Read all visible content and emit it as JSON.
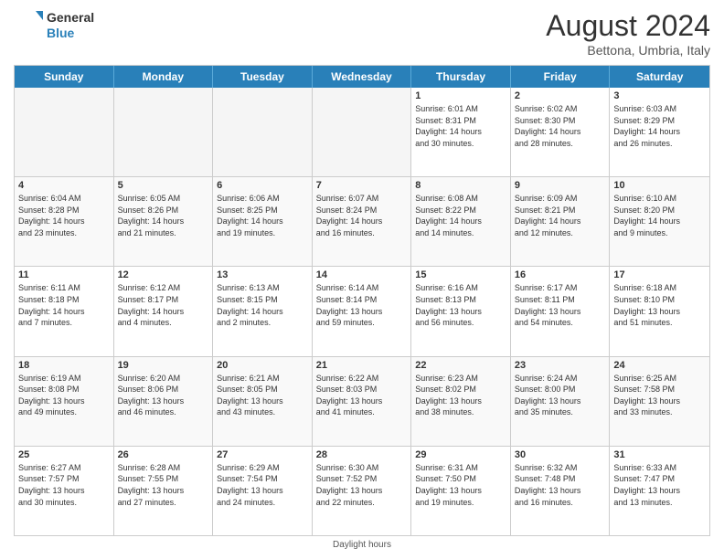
{
  "header": {
    "logo_general": "General",
    "logo_blue": "Blue",
    "month_title": "August 2024",
    "location": "Bettona, Umbria, Italy"
  },
  "days_of_week": [
    "Sunday",
    "Monday",
    "Tuesday",
    "Wednesday",
    "Thursday",
    "Friday",
    "Saturday"
  ],
  "weeks": [
    [
      {
        "day": "",
        "info": "",
        "empty": true
      },
      {
        "day": "",
        "info": "",
        "empty": true
      },
      {
        "day": "",
        "info": "",
        "empty": true
      },
      {
        "day": "",
        "info": "",
        "empty": true
      },
      {
        "day": "1",
        "info": "Sunrise: 6:01 AM\nSunset: 8:31 PM\nDaylight: 14 hours\nand 30 minutes.",
        "empty": false
      },
      {
        "day": "2",
        "info": "Sunrise: 6:02 AM\nSunset: 8:30 PM\nDaylight: 14 hours\nand 28 minutes.",
        "empty": false
      },
      {
        "day": "3",
        "info": "Sunrise: 6:03 AM\nSunset: 8:29 PM\nDaylight: 14 hours\nand 26 minutes.",
        "empty": false
      }
    ],
    [
      {
        "day": "4",
        "info": "Sunrise: 6:04 AM\nSunset: 8:28 PM\nDaylight: 14 hours\nand 23 minutes.",
        "empty": false
      },
      {
        "day": "5",
        "info": "Sunrise: 6:05 AM\nSunset: 8:26 PM\nDaylight: 14 hours\nand 21 minutes.",
        "empty": false
      },
      {
        "day": "6",
        "info": "Sunrise: 6:06 AM\nSunset: 8:25 PM\nDaylight: 14 hours\nand 19 minutes.",
        "empty": false
      },
      {
        "day": "7",
        "info": "Sunrise: 6:07 AM\nSunset: 8:24 PM\nDaylight: 14 hours\nand 16 minutes.",
        "empty": false
      },
      {
        "day": "8",
        "info": "Sunrise: 6:08 AM\nSunset: 8:22 PM\nDaylight: 14 hours\nand 14 minutes.",
        "empty": false
      },
      {
        "day": "9",
        "info": "Sunrise: 6:09 AM\nSunset: 8:21 PM\nDaylight: 14 hours\nand 12 minutes.",
        "empty": false
      },
      {
        "day": "10",
        "info": "Sunrise: 6:10 AM\nSunset: 8:20 PM\nDaylight: 14 hours\nand 9 minutes.",
        "empty": false
      }
    ],
    [
      {
        "day": "11",
        "info": "Sunrise: 6:11 AM\nSunset: 8:18 PM\nDaylight: 14 hours\nand 7 minutes.",
        "empty": false
      },
      {
        "day": "12",
        "info": "Sunrise: 6:12 AM\nSunset: 8:17 PM\nDaylight: 14 hours\nand 4 minutes.",
        "empty": false
      },
      {
        "day": "13",
        "info": "Sunrise: 6:13 AM\nSunset: 8:15 PM\nDaylight: 14 hours\nand 2 minutes.",
        "empty": false
      },
      {
        "day": "14",
        "info": "Sunrise: 6:14 AM\nSunset: 8:14 PM\nDaylight: 13 hours\nand 59 minutes.",
        "empty": false
      },
      {
        "day": "15",
        "info": "Sunrise: 6:16 AM\nSunset: 8:13 PM\nDaylight: 13 hours\nand 56 minutes.",
        "empty": false
      },
      {
        "day": "16",
        "info": "Sunrise: 6:17 AM\nSunset: 8:11 PM\nDaylight: 13 hours\nand 54 minutes.",
        "empty": false
      },
      {
        "day": "17",
        "info": "Sunrise: 6:18 AM\nSunset: 8:10 PM\nDaylight: 13 hours\nand 51 minutes.",
        "empty": false
      }
    ],
    [
      {
        "day": "18",
        "info": "Sunrise: 6:19 AM\nSunset: 8:08 PM\nDaylight: 13 hours\nand 49 minutes.",
        "empty": false
      },
      {
        "day": "19",
        "info": "Sunrise: 6:20 AM\nSunset: 8:06 PM\nDaylight: 13 hours\nand 46 minutes.",
        "empty": false
      },
      {
        "day": "20",
        "info": "Sunrise: 6:21 AM\nSunset: 8:05 PM\nDaylight: 13 hours\nand 43 minutes.",
        "empty": false
      },
      {
        "day": "21",
        "info": "Sunrise: 6:22 AM\nSunset: 8:03 PM\nDaylight: 13 hours\nand 41 minutes.",
        "empty": false
      },
      {
        "day": "22",
        "info": "Sunrise: 6:23 AM\nSunset: 8:02 PM\nDaylight: 13 hours\nand 38 minutes.",
        "empty": false
      },
      {
        "day": "23",
        "info": "Sunrise: 6:24 AM\nSunset: 8:00 PM\nDaylight: 13 hours\nand 35 minutes.",
        "empty": false
      },
      {
        "day": "24",
        "info": "Sunrise: 6:25 AM\nSunset: 7:58 PM\nDaylight: 13 hours\nand 33 minutes.",
        "empty": false
      }
    ],
    [
      {
        "day": "25",
        "info": "Sunrise: 6:27 AM\nSunset: 7:57 PM\nDaylight: 13 hours\nand 30 minutes.",
        "empty": false
      },
      {
        "day": "26",
        "info": "Sunrise: 6:28 AM\nSunset: 7:55 PM\nDaylight: 13 hours\nand 27 minutes.",
        "empty": false
      },
      {
        "day": "27",
        "info": "Sunrise: 6:29 AM\nSunset: 7:54 PM\nDaylight: 13 hours\nand 24 minutes.",
        "empty": false
      },
      {
        "day": "28",
        "info": "Sunrise: 6:30 AM\nSunset: 7:52 PM\nDaylight: 13 hours\nand 22 minutes.",
        "empty": false
      },
      {
        "day": "29",
        "info": "Sunrise: 6:31 AM\nSunset: 7:50 PM\nDaylight: 13 hours\nand 19 minutes.",
        "empty": false
      },
      {
        "day": "30",
        "info": "Sunrise: 6:32 AM\nSunset: 7:48 PM\nDaylight: 13 hours\nand 16 minutes.",
        "empty": false
      },
      {
        "day": "31",
        "info": "Sunrise: 6:33 AM\nSunset: 7:47 PM\nDaylight: 13 hours\nand 13 minutes.",
        "empty": false
      }
    ]
  ],
  "footer": {
    "daylight_label": "Daylight hours"
  }
}
